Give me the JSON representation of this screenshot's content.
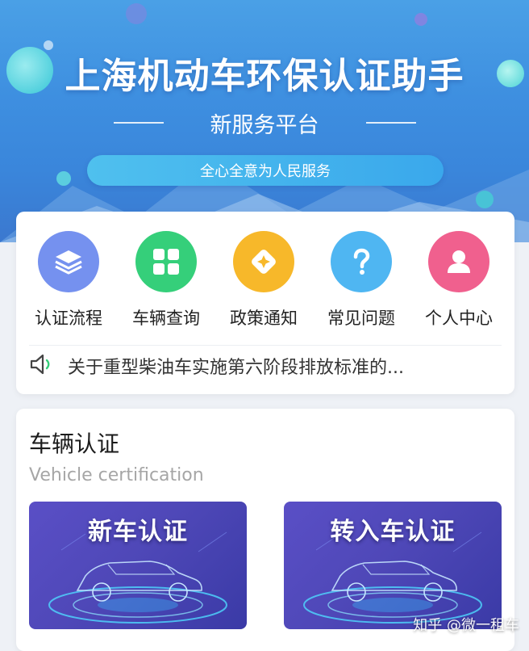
{
  "banner": {
    "title": "上海机动车环保认证助手",
    "subtitle": "新服务平台",
    "slogan": "全心全意为人民服务"
  },
  "menu": {
    "items": [
      {
        "label": "认证流程",
        "icon": "layers-icon",
        "color": "#6f8ff0"
      },
      {
        "label": "车辆查询",
        "icon": "grid-icon",
        "color": "#35cf7a"
      },
      {
        "label": "政策通知",
        "icon": "diamond-sparkle-icon",
        "color": "#f7b82a"
      },
      {
        "label": "常见问题",
        "icon": "question-icon",
        "color": "#4fb6f2"
      },
      {
        "label": "个人中心",
        "icon": "user-icon",
        "color": "#f0608e"
      }
    ]
  },
  "notice": {
    "icon": "speaker-icon",
    "text": "关于重型柴油车实施第六阶段排放标准的..."
  },
  "vehicle": {
    "title": "车辆认证",
    "subtitle": "Vehicle certification",
    "cards": [
      {
        "label": "新车认证"
      },
      {
        "label": "转入车认证"
      }
    ]
  },
  "watermark": "知乎 @微一租车"
}
